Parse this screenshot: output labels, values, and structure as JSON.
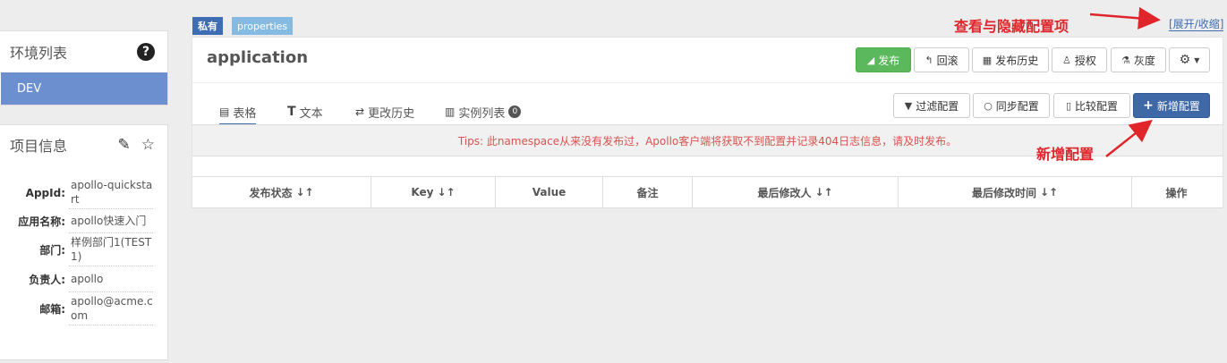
{
  "env_panel": {
    "title": "环境列表",
    "help_icon": "?",
    "envs": [
      {
        "label": "DEV",
        "active": true
      }
    ]
  },
  "project_panel": {
    "title": "项目信息",
    "edit_icon": "✎",
    "star_icon": "☆",
    "fields": [
      {
        "key": "AppId:",
        "value": "apollo-quickstart"
      },
      {
        "key": "应用名称:",
        "value": "apollo快速入门"
      },
      {
        "key": "部门:",
        "value": "样例部门1(TEST1)"
      },
      {
        "key": "负责人:",
        "value": "apollo"
      },
      {
        "key": "邮箱:",
        "value": "apollo@acme.com"
      }
    ]
  },
  "namespace": {
    "tag_private": "私有",
    "tag_format": "properties",
    "title": "application",
    "toggle_link": "[展开/收缩]",
    "actions": {
      "publish": "发布",
      "rollback": "回滚",
      "history": "发布历史",
      "grant": "授权",
      "gray": "灰度"
    },
    "tabs": [
      {
        "label": "表格",
        "icon": "table-icon",
        "active": true
      },
      {
        "label": "文本",
        "icon": "text-icon"
      },
      {
        "label": "更改历史",
        "icon": "history-icon"
      },
      {
        "label": "实例列表",
        "icon": "instances-icon",
        "badge": "0"
      }
    ],
    "tools": {
      "filter": "过滤配置",
      "sync": "同步配置",
      "compare": "比较配置",
      "add": "新增配置"
    },
    "tips": "Tips: 此namespace从来没有发布过，Apollo客户端将获取不到配置并记录404日志信息，请及时发布。",
    "columns": [
      "发布状态",
      "Key",
      "Value",
      "备注",
      "最后修改人",
      "最后修改时间",
      "操作"
    ]
  },
  "annotations": {
    "toggle": "查看与隐藏配置项",
    "add": "新增配置"
  },
  "colors": {
    "annotation_red": "#e0252b",
    "primary_blue": "#3f68a6",
    "success_green": "#5cb85c",
    "env_active": "#6b8fcf"
  }
}
